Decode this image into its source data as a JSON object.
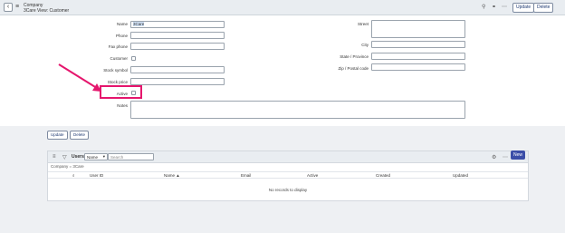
{
  "header": {
    "title": "Company",
    "subtitle": "3Care View: Customer",
    "update_label": "Update",
    "delete_label": "Delete"
  },
  "form": {
    "left": [
      {
        "label": "Name",
        "value": "3Care",
        "type": "text"
      },
      {
        "label": "Phone",
        "value": "",
        "type": "text"
      },
      {
        "label": "Fax phone",
        "value": "",
        "type": "text"
      },
      {
        "label": "Customer",
        "checked": false,
        "type": "checkbox"
      },
      {
        "label": "Stock symbol",
        "value": "",
        "type": "text"
      },
      {
        "label": "Stock price",
        "value": "",
        "type": "text"
      },
      {
        "label": "Active",
        "checked": false,
        "type": "checkbox"
      },
      {
        "label": "Notes",
        "value": "",
        "type": "textarea"
      }
    ],
    "right": [
      {
        "label": "Street",
        "value": "",
        "type": "textarea"
      },
      {
        "label": "City",
        "value": "",
        "type": "text"
      },
      {
        "label": "State / Province",
        "value": "",
        "type": "text"
      },
      {
        "label": "Zip / Postal code",
        "value": "",
        "type": "text"
      }
    ]
  },
  "actions": {
    "update_label": "Update",
    "delete_label": "Delete"
  },
  "related": {
    "title": "Users",
    "filter_field": "Name",
    "search_placeholder": "Search",
    "filter_crumb": "Company = 3Care",
    "new_label": "New",
    "columns": [
      "User ID",
      "Name ▲",
      "Email",
      "Active",
      "Created",
      "Updated"
    ],
    "empty_text": "No records to display"
  },
  "colors": {
    "highlight": "#e5166d",
    "primary": "#3b4ea8"
  }
}
